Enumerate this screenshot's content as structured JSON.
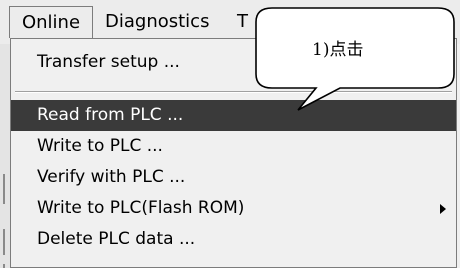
{
  "menubar": {
    "items": [
      {
        "label": "Online"
      },
      {
        "label": "Diagnostics"
      },
      {
        "label": "T"
      }
    ]
  },
  "dropdown": {
    "items": [
      {
        "label": "Transfer setup ..."
      },
      {
        "label": "Read from PLC ..."
      },
      {
        "label": "Write to PLC ..."
      },
      {
        "label": "Verify with PLC ..."
      },
      {
        "label": "Write to PLC(Flash ROM)"
      },
      {
        "label": "Delete PLC data ..."
      }
    ]
  },
  "callout": {
    "text": "1)点击"
  },
  "colors": {
    "highlight": "#3a3a3a",
    "menu_background": "#f0f0f0"
  }
}
